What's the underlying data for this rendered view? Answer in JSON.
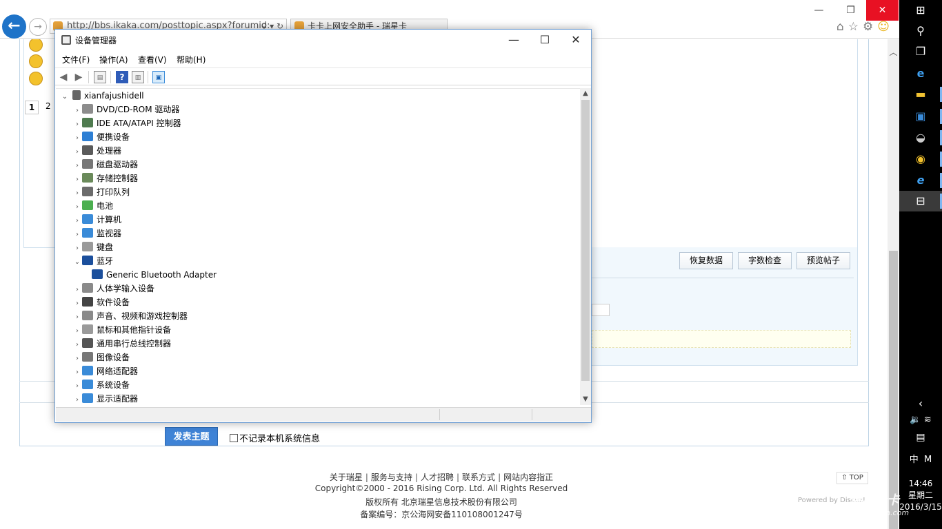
{
  "browser": {
    "address": "http://bbs.ikaka.com/posttopic.aspx?forumid:",
    "tab_title": "卡卡上网安全助手 - 瑞星卡",
    "back_icon": "arrow-left-icon",
    "forward_icon": "arrow-right-icon"
  },
  "page": {
    "pager_current": "1",
    "pager_next": "2",
    "buttons": [
      "恢复数据",
      "字数检查",
      "预览帖子"
    ],
    "submit_label": "发表主题",
    "checkbox_label": "不记录本机系统信息",
    "footer": {
      "links": [
        "关于瑞星",
        "服务与支持",
        "人才招聘",
        "联系方式",
        "网站内容指正"
      ],
      "copyright": "Copyright©2000 - 2016 Rising Corp. Ltd.  All Rights Reserved",
      "rights": "版权所有  北京瑞星信息技术股份有限公司",
      "icp": "备案编号：京公海网安备110108001247号",
      "top_label": "TOP",
      "powered": "Powered by Discuz!"
    }
  },
  "device_manager": {
    "title": "设备管理器",
    "menu": [
      "文件(F)",
      "操作(A)",
      "查看(V)",
      "帮助(H)"
    ],
    "root": "xianfajushidell",
    "nodes": [
      {
        "label": "DVD/CD-ROM 驱动器",
        "color": "#8c8c8c"
      },
      {
        "label": "IDE ATA/ATAPI 控制器",
        "color": "#4f7b4f"
      },
      {
        "label": "便携设备",
        "color": "#2e7fd4"
      },
      {
        "label": "处理器",
        "color": "#5a5a5a"
      },
      {
        "label": "磁盘驱动器",
        "color": "#777777"
      },
      {
        "label": "存储控制器",
        "color": "#6a8a5a"
      },
      {
        "label": "打印队列",
        "color": "#6b6b6b"
      },
      {
        "label": "电池",
        "color": "#4caf50"
      },
      {
        "label": "计算机",
        "color": "#3a8bd8"
      },
      {
        "label": "监视器",
        "color": "#3a8bd8"
      },
      {
        "label": "键盘",
        "color": "#9a9a9a"
      },
      {
        "label": "蓝牙",
        "color": "#1b4f9c",
        "expanded": true
      },
      {
        "label": "Generic Bluetooth Adapter",
        "color": "#1b4f9c",
        "child": true
      },
      {
        "label": "人体学输入设备",
        "color": "#8a8a8a"
      },
      {
        "label": "软件设备",
        "color": "#444444"
      },
      {
        "label": "声音、视频和游戏控制器",
        "color": "#8a8a8a"
      },
      {
        "label": "鼠标和其他指针设备",
        "color": "#9a9a9a"
      },
      {
        "label": "通用串行总线控制器",
        "color": "#555555"
      },
      {
        "label": "图像设备",
        "color": "#777777"
      },
      {
        "label": "网络适配器",
        "color": "#3a8bd8"
      },
      {
        "label": "系统设备",
        "color": "#3a8bd8"
      },
      {
        "label": "显示适配器",
        "color": "#3a8bd8"
      }
    ]
  },
  "taskbar": {
    "time": "14:46",
    "weekday": "星期二",
    "date": "2016/3/15",
    "ime": "中",
    "ime2": "M"
  },
  "watermark": {
    "brand": "瑞星卡卡",
    "url": "www.ikaka.com"
  }
}
